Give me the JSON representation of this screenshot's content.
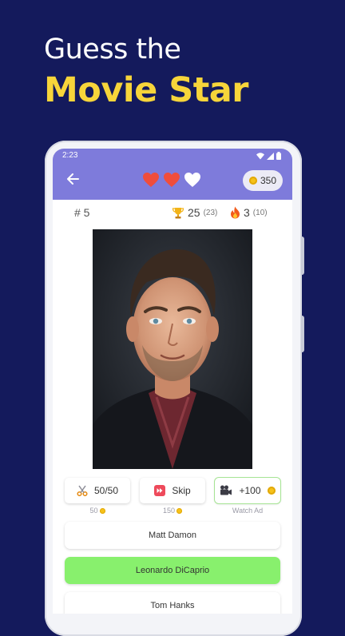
{
  "promo": {
    "line1": "Guess the",
    "line2": "Movie Star"
  },
  "status_bar": {
    "time": "2:23"
  },
  "header": {
    "coins": "350",
    "hearts": [
      "full",
      "full",
      "empty"
    ]
  },
  "stats": {
    "level": "# 5",
    "trophy_value": "25",
    "trophy_total": "(23)",
    "streak_value": "3",
    "streak_total": "(10)"
  },
  "helpers": [
    {
      "label": "50/50",
      "cost": "50",
      "icon": "scissors-icon"
    },
    {
      "label": "Skip",
      "cost": "150",
      "icon": "skip-icon"
    },
    {
      "label": "+100",
      "cost": "Watch Ad",
      "icon": "video-camera-icon"
    }
  ],
  "answers": [
    {
      "label": "Matt Damon",
      "state": "normal"
    },
    {
      "label": "Leonardo DiCaprio",
      "state": "correct"
    },
    {
      "label": "Tom Hanks",
      "state": "normal"
    }
  ],
  "colors": {
    "background": "#141a5c",
    "headline_accent": "#f7d53a",
    "appbar": "#7e7bdb",
    "heart": "#f04d3b",
    "correct_answer": "#88f06d"
  }
}
